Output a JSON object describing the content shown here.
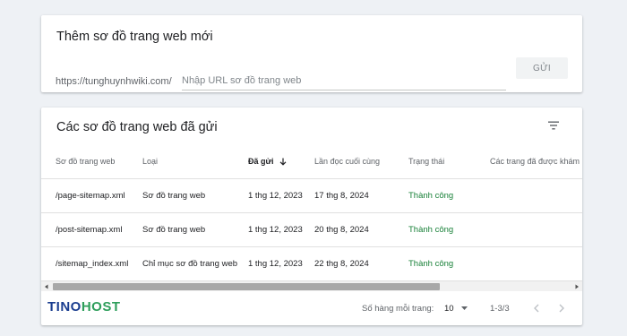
{
  "add_card": {
    "title": "Thêm sơ đồ trang web mới",
    "url_prefix": "https://tunghuynhwiki.com/",
    "url_placeholder": "Nhập URL sơ đồ trang web",
    "submit_label": "GỬI"
  },
  "list_card": {
    "title": "Các sơ đồ trang web đã gửi",
    "filter_icon": "filter-icon",
    "columns": [
      "Sơ đồ trang web",
      "Loại",
      "Đã gửi",
      "Lần đọc cuối cùng",
      "Trạng thái",
      "Các trang đã được khám p"
    ],
    "sorted_column_index": 2,
    "rows": [
      {
        "sitemap": "/page-sitemap.xml",
        "type": "Sơ đồ trang web",
        "submitted": "1 thg 12, 2023",
        "last_read": "17 thg 8, 2024",
        "status": "Thành công"
      },
      {
        "sitemap": "/post-sitemap.xml",
        "type": "Sơ đồ trang web",
        "submitted": "1 thg 12, 2023",
        "last_read": "20 thg 8, 2024",
        "status": "Thành công"
      },
      {
        "sitemap": "/sitemap_index.xml",
        "type": "Chỉ mục sơ đồ trang web",
        "submitted": "1 thg 12, 2023",
        "last_read": "22 thg 8, 2024",
        "status": "Thành công"
      }
    ],
    "pagination": {
      "rows_per_page_label": "Số hàng mỗi trang:",
      "rows_per_page_value": "10",
      "range": "1-3/3"
    }
  },
  "brand": {
    "logo_part1": "TINO",
    "logo_part2": "HOST"
  },
  "colors": {
    "status_success": "#188038",
    "logo_blue": "#1a3d8f",
    "logo_green": "#2e9e5b"
  }
}
